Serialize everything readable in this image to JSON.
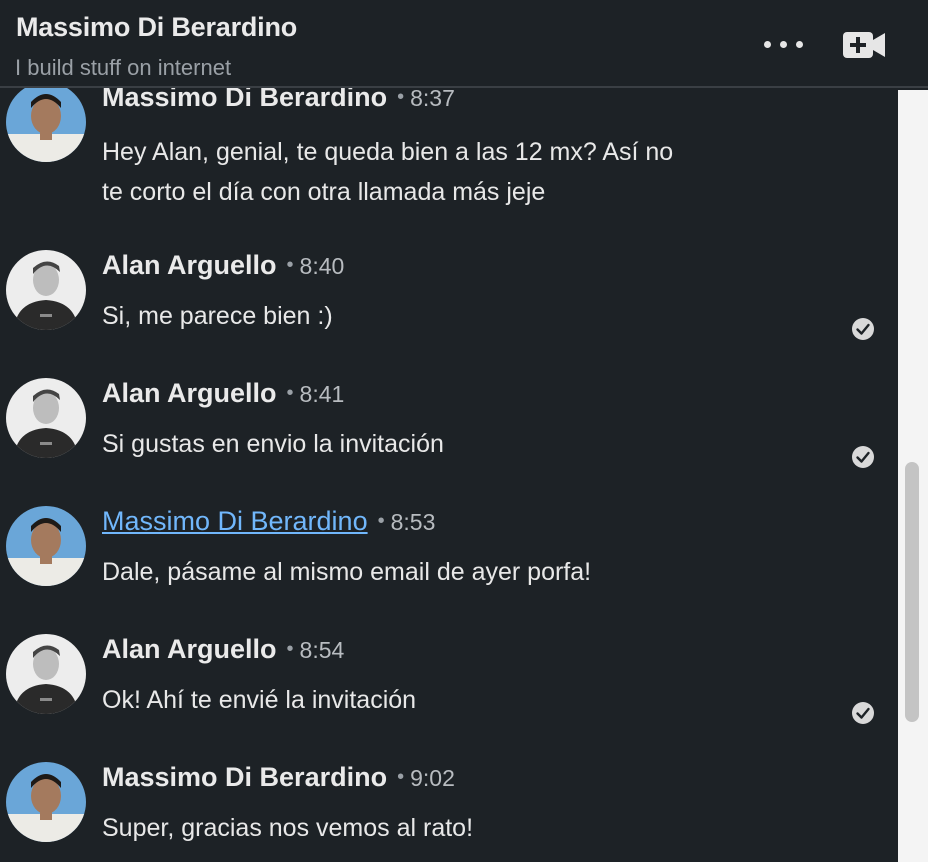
{
  "header": {
    "name": "Massimo Di Berardino",
    "headline": "I build stuff on internet",
    "more_icon": "ellipsis-icon",
    "video_icon": "video-call-plus-icon"
  },
  "messages": [
    {
      "sender": "Massimo Di Berardino",
      "separator": "•",
      "time": "8:37",
      "lines": [
        "Hey Alan, genial, te queda bien a las 12 mx? Así no",
        "te corto el día con otra llamada más jeje"
      ],
      "read": false
    },
    {
      "sender": "Alan Arguello",
      "separator": "•",
      "time": "8:40",
      "lines": [
        "Si, me parece bien :)"
      ],
      "read": true
    },
    {
      "sender": "Alan Arguello",
      "separator": "•",
      "time": "8:41",
      "lines": [
        "Si gustas en envio la invitación"
      ],
      "read": true
    },
    {
      "sender": "Massimo Di Berardino",
      "separator": "•",
      "time": "8:53",
      "lines": [
        "Dale, pásame al mismo email de ayer porfa!"
      ],
      "read": false,
      "hovered": true
    },
    {
      "sender": "Alan Arguello",
      "separator": "•",
      "time": "8:54",
      "lines": [
        "Ok! Ahí te envié la invitación"
      ],
      "read": true
    },
    {
      "sender": "Massimo Di Berardino",
      "separator": "•",
      "time": "9:02",
      "lines": [
        "Super, gracias nos vemos al rato!"
      ],
      "read": false
    }
  ],
  "colors": {
    "background": "#1d2226",
    "link": "#71b7fb",
    "text": "#e8e8e8",
    "muted": "#9aa0a6"
  }
}
